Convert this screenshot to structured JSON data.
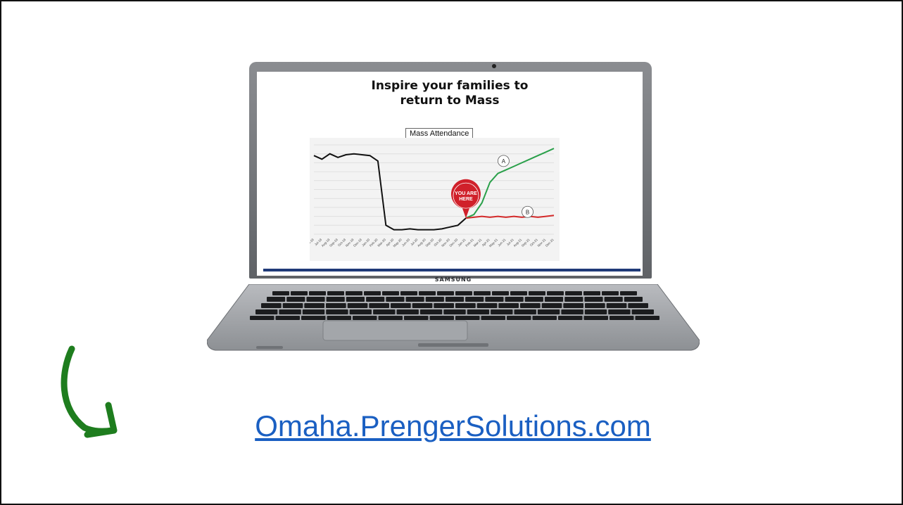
{
  "screen": {
    "title_line1": "Inspire your families to",
    "title_line2": "return to Mass",
    "brand": "SAMSUNG"
  },
  "chart_data": {
    "type": "line",
    "title": "Mass Attendance",
    "x": [
      "Jun-19",
      "Jul-19",
      "Aug-19",
      "Sep-19",
      "Oct-19",
      "Nov-19",
      "Dec-19",
      "Jan-20",
      "Feb-20",
      "Mar-20",
      "Apr-20",
      "May-20",
      "Jun-20",
      "Jul-20",
      "Aug-20",
      "Sep-20",
      "Oct-20",
      "Nov-20",
      "Dec-20",
      "Jan-21",
      "Feb-21",
      "Mar-21",
      "Apr-21",
      "May-21",
      "Jun-21",
      "Jul-21",
      "Aug-21",
      "Sep-21",
      "Oct-21",
      "Nov-21",
      "Dec-21"
    ],
    "series": [
      {
        "name": "",
        "values": [
          88,
          84,
          90,
          86,
          89,
          90,
          89,
          88,
          82,
          10,
          5,
          5,
          6,
          5,
          5,
          5,
          6,
          8,
          10,
          18,
          null,
          null,
          null,
          null,
          null,
          null,
          null,
          null,
          null,
          null,
          null
        ]
      },
      {
        "name": "A",
        "values": [
          null,
          null,
          null,
          null,
          null,
          null,
          null,
          null,
          null,
          null,
          null,
          null,
          null,
          null,
          null,
          null,
          null,
          null,
          null,
          18,
          22,
          35,
          58,
          68,
          72,
          76,
          80,
          84,
          88,
          92,
          96
        ]
      },
      {
        "name": "B",
        "values": [
          null,
          null,
          null,
          null,
          null,
          null,
          null,
          null,
          null,
          null,
          null,
          null,
          null,
          null,
          null,
          null,
          null,
          null,
          null,
          18,
          19,
          20,
          19,
          20,
          19,
          20,
          19,
          20,
          19,
          20,
          21
        ]
      }
    ],
    "annotations": [
      "YOU ARE",
      "HERE",
      "A",
      "B"
    ],
    "colors": {
      "history": "#111111",
      "A": "#2aa04a",
      "B": "#d42a2a",
      "marker": "#d0202a"
    }
  },
  "url": "Omaha.PrengerSolutions.com",
  "colors": {
    "link": "#1a5fc2",
    "arrow": "#1e7d1e"
  }
}
